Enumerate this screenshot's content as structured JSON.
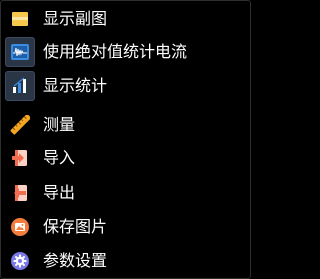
{
  "menu": {
    "items": [
      {
        "label": "显示副图",
        "icon": "subchart-icon"
      },
      {
        "label": "使用绝对值统计电流",
        "icon": "waveform-chart-icon"
      },
      {
        "label": "显示统计",
        "icon": "bar-stats-icon"
      },
      {
        "label": "测量",
        "icon": "ruler-icon"
      },
      {
        "label": "导入",
        "icon": "import-icon"
      },
      {
        "label": "导出",
        "icon": "export-icon"
      },
      {
        "label": "保存图片",
        "icon": "image-icon"
      },
      {
        "label": "参数设置",
        "icon": "gear-icon"
      }
    ]
  },
  "colors": {
    "background": "#000000",
    "text": "#ffffff",
    "subchart_icon": "#f6c94b",
    "ruler_icon": "#f5a623",
    "import_export_icon": "#f26d4f",
    "image_icon": "#f47c3c",
    "gear_icon": "#7b79e8",
    "checked_box": "#2a3546"
  }
}
